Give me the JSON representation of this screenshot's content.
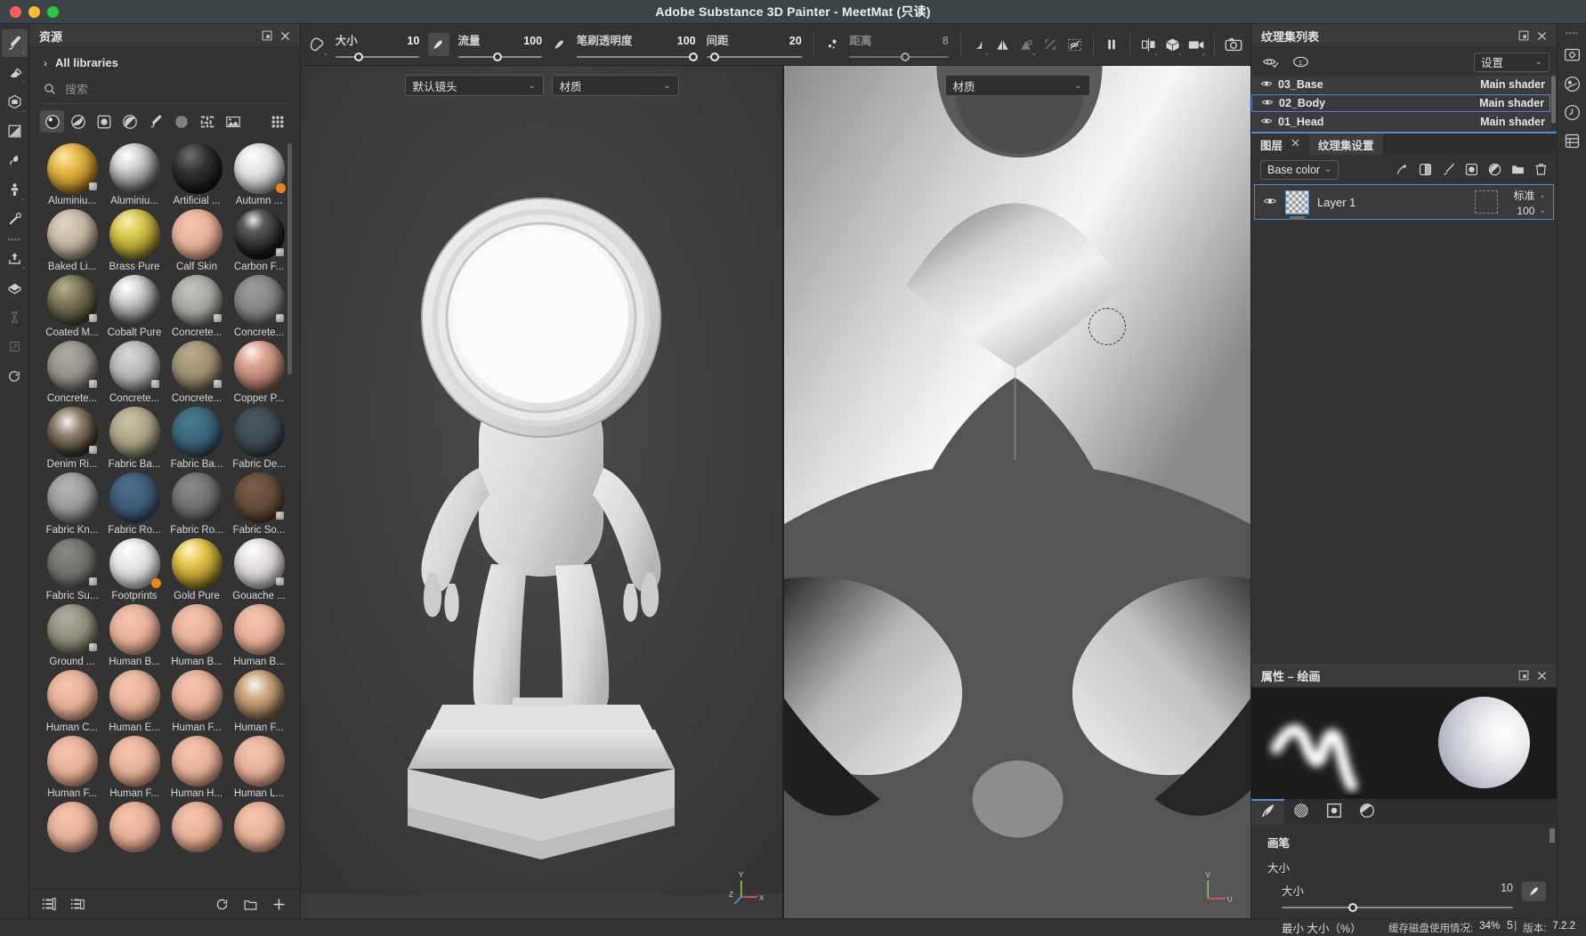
{
  "window": {
    "title": "Adobe Substance 3D Painter - MeetMat (只读)",
    "controls": [
      "close",
      "minimize",
      "maximize"
    ]
  },
  "left_tool_rail": {
    "tools": [
      {
        "name": "paint-brush-tool",
        "icon": "brush-icon",
        "active": true,
        "has_caret": true,
        "dim": false
      },
      {
        "name": "eraser-tool",
        "icon": "eraser-icon",
        "active": false,
        "has_caret": true,
        "dim": false
      },
      {
        "name": "projection-tool",
        "icon": "projection-cube-icon",
        "active": false,
        "has_caret": true,
        "dim": false
      },
      {
        "name": "polygon-fill-tool",
        "icon": "polygon-fill-icon",
        "active": false,
        "has_caret": false,
        "dim": false
      },
      {
        "name": "smudge-tool",
        "icon": "smudge-icon",
        "active": false,
        "has_caret": false,
        "dim": false
      },
      {
        "name": "clone-tool",
        "icon": "clone-stamp-icon",
        "active": false,
        "has_caret": true,
        "dim": false
      },
      {
        "name": "color-picker-tool",
        "icon": "eyedropper-icon",
        "active": false,
        "has_caret": false,
        "dim": false
      },
      {
        "name": "export-tool",
        "icon": "export-upload-icon",
        "active": false,
        "has_caret": true,
        "dim": false
      },
      {
        "name": "bake-tool",
        "icon": "bake-mesh-icon",
        "active": false,
        "has_caret": false,
        "dim": false
      },
      {
        "name": "hourglass-tool",
        "icon": "hourglass-icon",
        "active": false,
        "has_caret": false,
        "dim": true
      },
      {
        "name": "resize-tool",
        "icon": "resize-arrows-icon",
        "active": false,
        "has_caret": false,
        "dim": true
      },
      {
        "name": "reload-tool",
        "icon": "reload-icon",
        "active": false,
        "has_caret": false,
        "dim": false
      }
    ]
  },
  "assets_panel": {
    "title": "资源",
    "header_icons": [
      "undock-icon",
      "close-icon"
    ],
    "breadcrumb": "All libraries",
    "search": {
      "placeholder": "搜索",
      "value": "",
      "icon": "search-icon"
    },
    "filters": [
      {
        "name": "filter-materials",
        "icon": "sphere-material-icon",
        "active": true
      },
      {
        "name": "filter-smart-materials",
        "icon": "smart-material-icon",
        "active": false
      },
      {
        "name": "filter-masks",
        "icon": "mask-icon",
        "active": false
      },
      {
        "name": "filter-smart-masks",
        "icon": "smart-mask-icon",
        "active": false
      },
      {
        "name": "filter-brushes",
        "icon": "brush-icon",
        "active": false
      },
      {
        "name": "filter-alphas",
        "icon": "alpha-grid-icon",
        "active": false
      },
      {
        "name": "filter-textures",
        "icon": "texture-icon",
        "active": false
      },
      {
        "name": "filter-environments",
        "icon": "environment-icon",
        "active": false
      },
      {
        "name": "view-mode-grid",
        "icon": "grid-view-icon",
        "active": false
      }
    ],
    "assets": [
      {
        "label": "Aluminiu...",
        "style": "gold-hammered",
        "badge": "material"
      },
      {
        "label": "Aluminiu...",
        "style": "chrome",
        "badge": "none"
      },
      {
        "label": "Artificial ...",
        "style": "black-gloss",
        "badge": "none"
      },
      {
        "label": "Autumn ...",
        "style": "leaf-decal",
        "badge": "orange"
      },
      {
        "label": "Baked Li...",
        "style": "beige-matte",
        "badge": "none"
      },
      {
        "label": "Brass Pure",
        "style": "brass",
        "badge": "none"
      },
      {
        "label": "Calf Skin",
        "style": "skin",
        "badge": "none"
      },
      {
        "label": "Carbon F...",
        "style": "carbon",
        "badge": "material"
      },
      {
        "label": "Coated M...",
        "style": "olive-gloss",
        "badge": "material"
      },
      {
        "label": "Cobalt Pure",
        "style": "chrome",
        "badge": "none"
      },
      {
        "label": "Concrete...",
        "style": "concrete-light",
        "badge": "material"
      },
      {
        "label": "Concrete...",
        "style": "concrete-grey",
        "badge": "material"
      },
      {
        "label": "Concrete...",
        "style": "concrete-rough",
        "badge": "material"
      },
      {
        "label": "Concrete...",
        "style": "concrete-dark",
        "badge": "material"
      },
      {
        "label": "Concrete...",
        "style": "concrete-tan",
        "badge": "material"
      },
      {
        "label": "Copper P...",
        "style": "copper",
        "badge": "none"
      },
      {
        "label": "Denim Ri...",
        "style": "denim-rivet",
        "badge": "material"
      },
      {
        "label": "Fabric Ba...",
        "style": "fabric-khaki",
        "badge": "none"
      },
      {
        "label": "Fabric Ba...",
        "style": "fabric-teal",
        "badge": "none"
      },
      {
        "label": "Fabric De...",
        "style": "fabric-slate",
        "badge": "none"
      },
      {
        "label": "Fabric Kn...",
        "style": "fabric-grey",
        "badge": "none"
      },
      {
        "label": "Fabric Ro...",
        "style": "fabric-blue",
        "badge": "none"
      },
      {
        "label": "Fabric Ro...",
        "style": "fabric-darkgrey",
        "badge": "none"
      },
      {
        "label": "Fabric So...",
        "style": "fabric-brown",
        "badge": "material"
      },
      {
        "label": "Fabric Su...",
        "style": "fabric-mesh",
        "badge": "material"
      },
      {
        "label": "Footprints",
        "style": "footprints",
        "badge": "orange"
      },
      {
        "label": "Gold Pure",
        "style": "gold",
        "badge": "none"
      },
      {
        "label": "Gouache ...",
        "style": "gouache",
        "badge": "material"
      },
      {
        "label": "Ground ...",
        "style": "ground",
        "badge": "material"
      },
      {
        "label": "Human B...",
        "style": "skin",
        "badge": "none"
      },
      {
        "label": "Human B...",
        "style": "skin",
        "badge": "none"
      },
      {
        "label": "Human B...",
        "style": "skin",
        "badge": "none"
      },
      {
        "label": "Human C...",
        "style": "skin",
        "badge": "none"
      },
      {
        "label": "Human E...",
        "style": "skin",
        "badge": "none"
      },
      {
        "label": "Human F...",
        "style": "skin",
        "badge": "none"
      },
      {
        "label": "Human F...",
        "style": "face",
        "badge": "none"
      },
      {
        "label": "Human F...",
        "style": "skin",
        "badge": "none"
      },
      {
        "label": "Human F...",
        "style": "skin",
        "badge": "none"
      },
      {
        "label": "Human H...",
        "style": "skin",
        "badge": "none"
      },
      {
        "label": "Human L...",
        "style": "skin",
        "badge": "none"
      },
      {
        "label": "",
        "style": "skin",
        "badge": "none"
      },
      {
        "label": "",
        "style": "skin",
        "badge": "none"
      },
      {
        "label": "",
        "style": "skin",
        "badge": "none"
      },
      {
        "label": "",
        "style": "skin",
        "badge": "none"
      }
    ],
    "footer_icons": [
      {
        "name": "library-list-icon"
      },
      {
        "name": "library-folder-icon"
      },
      {
        "name": "refresh-icon"
      },
      {
        "name": "new-folder-icon"
      },
      {
        "name": "add-icon"
      }
    ]
  },
  "toolbar": {
    "shape_icon": "brush-shape-icon",
    "sliders": [
      {
        "name": "size",
        "label": "大小",
        "value": "10",
        "percent": 22,
        "dim": false
      },
      {
        "name": "flow",
        "label": "流量",
        "value": "100",
        "percent": 42,
        "dim": false
      },
      {
        "name": "brush-opacity",
        "label": "笔刷透明度",
        "value": "100",
        "percent": 94,
        "dim": false
      },
      {
        "name": "spacing",
        "label": "间距",
        "value": "20",
        "percent": 5,
        "dim": false
      },
      {
        "name": "distance",
        "label": "距离",
        "value": "8",
        "percent": 52,
        "dim": true
      }
    ],
    "brush_swatch_icon": "brush-tip-icon",
    "flow_swatch_icon": "flow-tip-icon",
    "symmetry_icon": "symmetry-dots-icon",
    "right_icons": [
      {
        "name": "falloff-curve-icon",
        "dim": false,
        "caret": true
      },
      {
        "name": "symmetry-mirror-icon",
        "dim": false,
        "caret": false
      },
      {
        "name": "symmetry-settings-icon",
        "dim": true,
        "caret": true
      },
      {
        "name": "uv-transform-icon",
        "dim": true,
        "caret": false
      },
      {
        "name": "hide-unselected-icon",
        "dim": false,
        "caret": false
      },
      {
        "name": "pause-engine-icon",
        "dim": false,
        "caret": false
      },
      {
        "name": "viewport-split-icon",
        "dim": false,
        "caret": true
      },
      {
        "name": "display-cube-icon",
        "dim": false,
        "caret": true
      },
      {
        "name": "camera-video-icon",
        "dim": false,
        "caret": true
      },
      {
        "name": "screenshot-camera-icon",
        "dim": false,
        "caret": false
      }
    ]
  },
  "viewport_3d": {
    "camera_dropdown": {
      "label": "默认镜头"
    },
    "material_dropdown": {
      "label": "材质"
    },
    "axis_labels": [
      "Y",
      "Z",
      "X"
    ]
  },
  "viewport_2d": {
    "material_dropdown": {
      "label": "材质"
    },
    "axis_labels": [
      "V",
      "U"
    ]
  },
  "texture_set_list": {
    "title": "纹理集列表",
    "header_icons": [
      "undock-icon",
      "close-icon"
    ],
    "toolbar_icons": [
      "visibility-toggle-icon",
      "single-channel-icon"
    ],
    "settings_dropdown": {
      "label": "设置"
    },
    "sets": [
      {
        "name": "01_Head",
        "shader": "Main shader",
        "visible": true,
        "selected": false
      },
      {
        "name": "02_Body",
        "shader": "Main shader",
        "visible": true,
        "selected": true
      },
      {
        "name": "03_Base",
        "shader": "Main shader",
        "visible": true,
        "selected": false
      }
    ]
  },
  "layers_panel": {
    "tabs": [
      {
        "label": "图层",
        "active": true,
        "closable": true
      },
      {
        "label": "纹理集设置",
        "active": false,
        "closable": false
      }
    ],
    "channel_dropdown": {
      "label": "Base color"
    },
    "toolbar_icons": [
      {
        "name": "add-effect-icon"
      },
      {
        "name": "add-fill-layer-icon"
      },
      {
        "name": "add-paint-layer-icon"
      },
      {
        "name": "add-mask-icon"
      },
      {
        "name": "add-filter-icon"
      },
      {
        "name": "add-folder-icon"
      },
      {
        "name": "delete-layer-icon"
      }
    ],
    "layers": [
      {
        "name": "Layer 1",
        "visible": true,
        "selected": true,
        "blend_mode": "标准",
        "opacity": "100"
      }
    ]
  },
  "properties_panel": {
    "title": "属性 – 绘画",
    "header_icons": [
      "undock-icon",
      "close-icon"
    ],
    "tabs": [
      {
        "name": "brush-tab",
        "icon": "brush-stroke-icon",
        "active": true
      },
      {
        "name": "alpha-tab",
        "icon": "alpha-grid-icon",
        "active": false
      },
      {
        "name": "stencil-tab",
        "icon": "stencil-icon",
        "active": false
      },
      {
        "name": "material-tab",
        "icon": "material-sphere-icon",
        "active": false
      }
    ],
    "section_title": "画笔",
    "group_title": "大小",
    "settings": [
      {
        "label": "大小",
        "value": "10",
        "percent": 29,
        "has_swatch": true
      },
      {
        "label": "最小 大小（%）",
        "value": "5",
        "percent": 5,
        "has_swatch": false
      }
    ]
  },
  "right_rail": {
    "buttons": [
      {
        "name": "display-settings-icon"
      },
      {
        "name": "environment-settings-icon"
      },
      {
        "name": "history-icon"
      },
      {
        "name": "shelf-icon"
      }
    ]
  },
  "statusbar": {
    "items": [
      {
        "label": "缓存磁盘使用情况:",
        "value": "34%"
      },
      {
        "label": "版本:",
        "value": "7.2.2"
      }
    ],
    "separator": "|"
  },
  "colors": {
    "accent": "#4e8ed8",
    "panel_bg": "#333333",
    "titlebar_bg": "#3c4448",
    "viewport_3d_bg": "#3b3b3b",
    "viewport_2d_bg": "#545454"
  }
}
